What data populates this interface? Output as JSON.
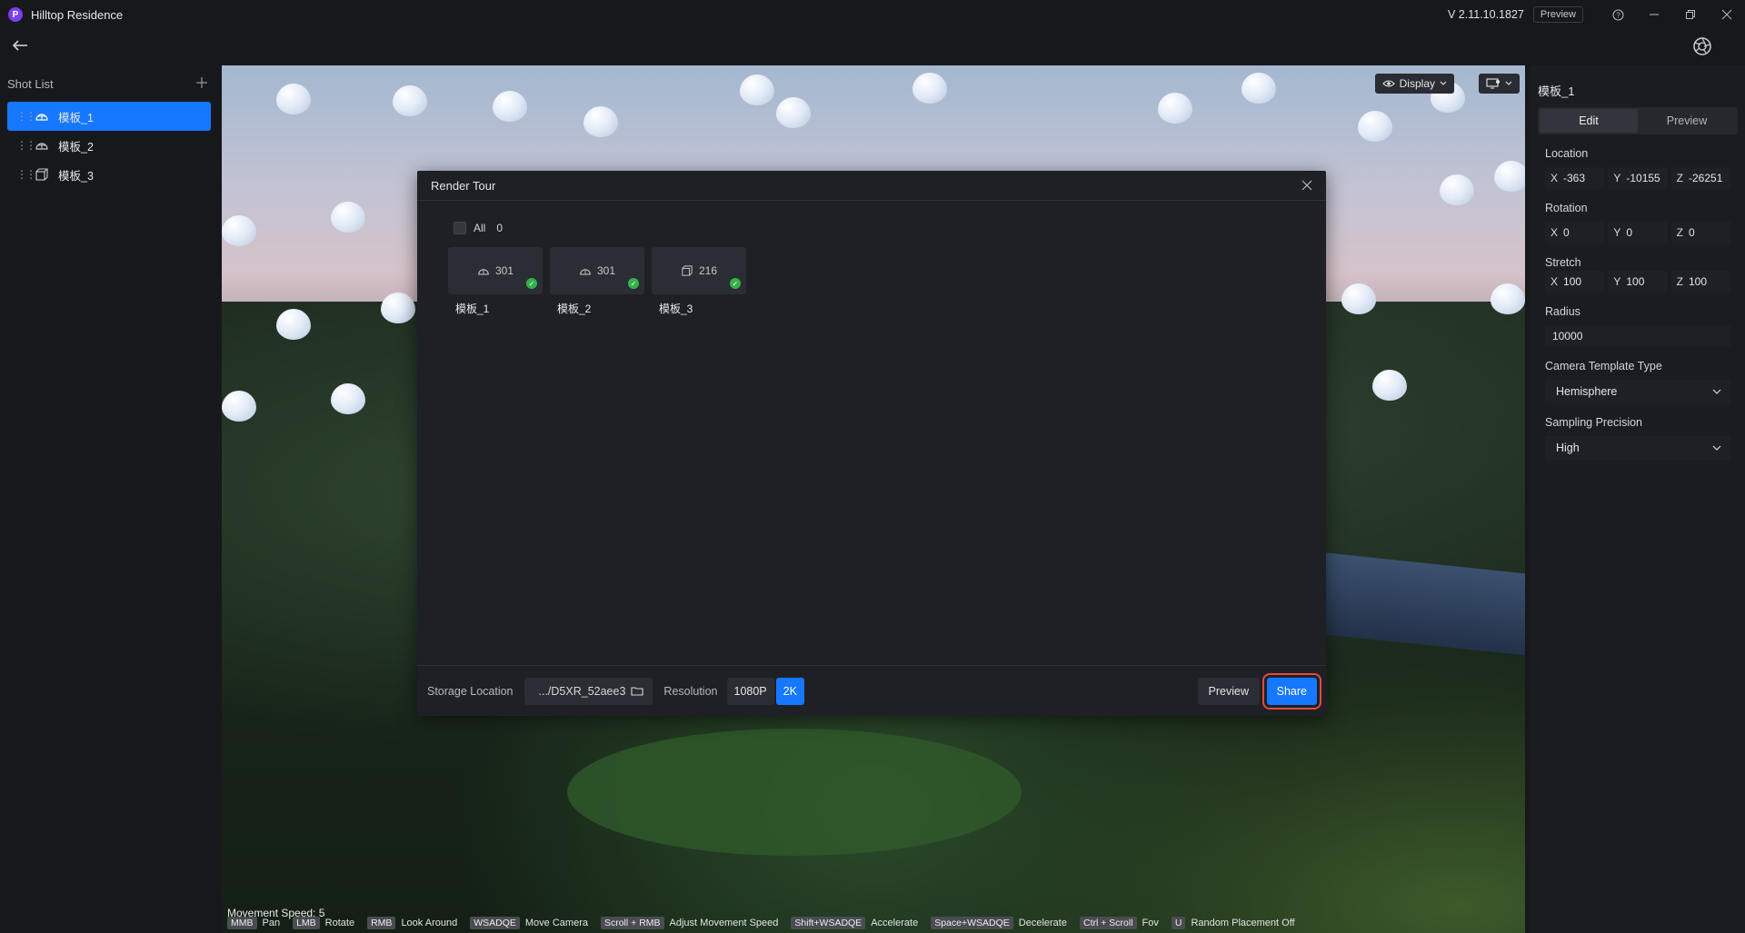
{
  "app": {
    "logo_letter": "P",
    "title": "Hilltop Residence",
    "version": "V 2.11.10.1827",
    "preview_tag": "Preview"
  },
  "shot_list": {
    "title": "Shot List",
    "items": [
      {
        "label": "模板_1",
        "icon": "hemisphere-icon",
        "active": true
      },
      {
        "label": "模板_2",
        "icon": "hemisphere-icon",
        "active": false
      },
      {
        "label": "模板_3",
        "icon": "cube-icon",
        "active": false
      }
    ]
  },
  "viewport": {
    "display_label": "Display",
    "movement_speed": "Movement Speed: 5",
    "hints": [
      {
        "key": "MMB",
        "text": "Pan"
      },
      {
        "key": "LMB",
        "text": "Rotate"
      },
      {
        "key": "RMB",
        "text": "Look Around"
      },
      {
        "key": "WSADQE",
        "text": "Move Camera"
      },
      {
        "key": "Scroll + RMB",
        "text": "Adjust Movement Speed"
      },
      {
        "key": "Shift+WSADQE",
        "text": "Accelerate"
      },
      {
        "key": "Space+WSADQE",
        "text": "Decelerate"
      },
      {
        "key": "Ctrl + Scroll",
        "text": "Fov"
      },
      {
        "key": "U",
        "text": "Random Placement Off"
      }
    ]
  },
  "modal": {
    "title": "Render Tour",
    "all_label": "All",
    "all_count": "0",
    "cards": [
      {
        "count": "301",
        "label": "模板_1",
        "icon": "hemisphere-icon"
      },
      {
        "count": "301",
        "label": "模板_2",
        "icon": "hemisphere-icon"
      },
      {
        "count": "216",
        "label": "模板_3",
        "icon": "cube-icon"
      }
    ],
    "storage_label": "Storage Location",
    "storage_value": ".../D5XR_52aee3",
    "resolution_label": "Resolution",
    "res_options": [
      "1080P",
      "2K"
    ],
    "res_selected": "2K",
    "preview_button": "Preview",
    "share_button": "Share"
  },
  "inspector": {
    "title": "模板_1",
    "tabs": [
      "Edit",
      "Preview"
    ],
    "active_tab": "Edit",
    "location": {
      "label": "Location",
      "x": "-363",
      "y": "-10155",
      "z": "-26251"
    },
    "rotation": {
      "label": "Rotation",
      "x": "0",
      "y": "0",
      "z": "0"
    },
    "stretch": {
      "label": "Stretch",
      "x": "100",
      "y": "100",
      "z": "100"
    },
    "radius": {
      "label": "Radius",
      "value": "10000"
    },
    "camera_type": {
      "label": "Camera Template Type",
      "value": "Hemisphere"
    },
    "sampling": {
      "label": "Sampling Precision",
      "value": "High"
    }
  },
  "colors": {
    "accent": "#1677ff",
    "highlight": "#e14b3b",
    "success": "#35b24a"
  }
}
